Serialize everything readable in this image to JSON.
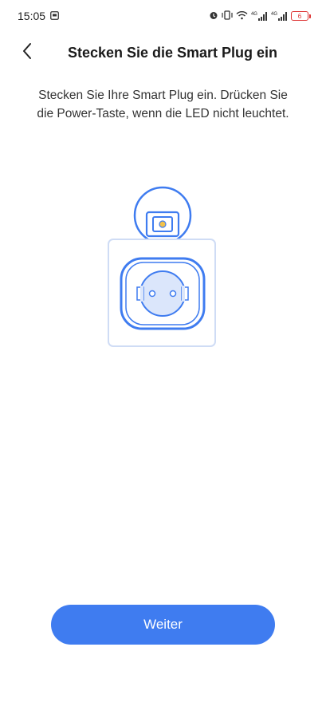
{
  "status_bar": {
    "time": "15:05",
    "battery_level": "6",
    "icons": [
      "notification-icon",
      "alarm-icon",
      "vibrate-icon",
      "wifi-icon",
      "signal-4g-icon",
      "signal-4g-icon-2",
      "battery-icon"
    ],
    "network_label_1": "4G",
    "network_label_2": "4G"
  },
  "header": {
    "back_icon": "chevron-left-icon",
    "title": "Stecken Sie die Smart Plug ein"
  },
  "instruction": "Stecken Sie Ihre Smart Plug ein. Drücken Sie die Power-Taste, wenn die LED nicht leuchtet.",
  "illustration": {
    "icon": "smart-plug-icon",
    "accent_color": "#3f7cf0",
    "frame_color": "#cfdcf5"
  },
  "actions": {
    "next_label": "Weiter",
    "button_color": "#3f7cf0"
  }
}
